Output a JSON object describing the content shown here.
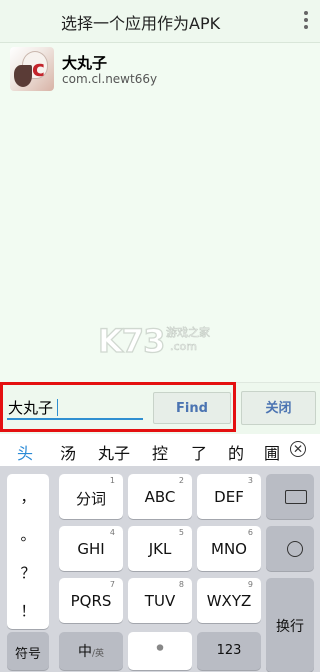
{
  "header": {
    "title": "选择一个应用作为APK",
    "menu_icon": "more-vert-icon"
  },
  "app_list": {
    "items": [
      {
        "name": "大丸子",
        "package": "com.cl.newt66y",
        "icon": "app-icon"
      }
    ]
  },
  "watermark": {
    "brand": "K73",
    "text_cn": "游戏之家",
    "text_domain": ".com"
  },
  "search": {
    "value": "大丸子",
    "find_label": "Find",
    "close_label": "关闭"
  },
  "colors": {
    "highlight_border": "#e41010",
    "accent": "#2f8fd1",
    "button_text": "#4b74b2"
  },
  "ime": {
    "candidates": [
      "头",
      "汤",
      "丸子",
      "控",
      "了",
      "的",
      "圃"
    ],
    "candidate_close_icon": "close-circle-icon",
    "punctuation": [
      "，",
      "。",
      "？",
      "！"
    ],
    "rows": [
      [
        {
          "num": "1",
          "label": "分词"
        },
        {
          "num": "2",
          "label": "ABC"
        },
        {
          "num": "3",
          "label": "DEF"
        }
      ],
      [
        {
          "num": "4",
          "label": "GHI"
        },
        {
          "num": "5",
          "label": "JKL"
        },
        {
          "num": "6",
          "label": "MNO"
        }
      ],
      [
        {
          "num": "7",
          "label": "PQRS"
        },
        {
          "num": "8",
          "label": "TUV"
        },
        {
          "num": "9",
          "label": "WXYZ"
        }
      ]
    ],
    "symbols_label": "符号",
    "lang_label": "中",
    "lang_sub": "/英",
    "space_icon": "microphone-icon",
    "num_label": "123",
    "enter_label": "换行",
    "backspace_icon": "backspace-icon",
    "emoji_icon": "emoji-icon"
  }
}
